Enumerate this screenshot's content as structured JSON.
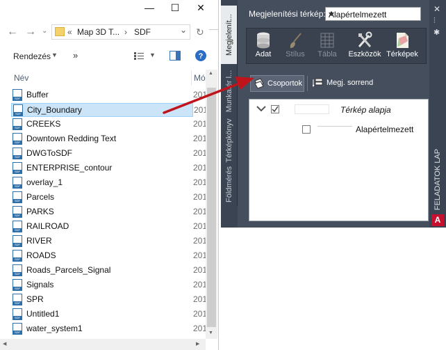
{
  "explorer": {
    "window_controls": {
      "minimize": "—",
      "maximize": "☐",
      "close": "✕"
    },
    "address": {
      "overflow": "«",
      "parent": "Map 3D T...",
      "separator": "›",
      "current": "SDF"
    },
    "toolbar": {
      "organize_label": "Rendezés",
      "more": "»"
    },
    "columns": {
      "name": "Név",
      "modified": "Mó"
    },
    "files": [
      {
        "name": "Buffer",
        "date": "201"
      },
      {
        "name": "City_Boundary",
        "date": "201",
        "selected": true
      },
      {
        "name": "CREEKS",
        "date": "201"
      },
      {
        "name": "Downtown Redding Text",
        "date": "201"
      },
      {
        "name": "DWGToSDF",
        "date": "201"
      },
      {
        "name": "ENTERPRISE_contour",
        "date": "201"
      },
      {
        "name": "overlay_1",
        "date": "201"
      },
      {
        "name": "Parcels",
        "date": "201"
      },
      {
        "name": "PARKS",
        "date": "201"
      },
      {
        "name": "RAILROAD",
        "date": "201"
      },
      {
        "name": "RIVER",
        "date": "201"
      },
      {
        "name": "ROADS",
        "date": "201"
      },
      {
        "name": "Roads_Parcels_Signal",
        "date": "201"
      },
      {
        "name": "Signals",
        "date": "201"
      },
      {
        "name": "SPR",
        "date": "201"
      },
      {
        "name": "Untitled1",
        "date": "201"
      },
      {
        "name": "water_system1",
        "date": "201"
      }
    ]
  },
  "panel": {
    "vertical_tabs": [
      "Megjelenít...",
      "Munkatér l...",
      "Térképkönyv",
      "Földmérés"
    ],
    "map_label": "Megjelenítési térkép:",
    "map_value": "Alapértelmezett",
    "ribbon": [
      {
        "label": "Adat",
        "icon": "database-icon",
        "enabled": true
      },
      {
        "label": "Stílus",
        "icon": "brush-icon",
        "enabled": false
      },
      {
        "label": "Tábla",
        "icon": "table-icon",
        "enabled": false
      },
      {
        "label": "Eszközök",
        "icon": "tools-icon",
        "enabled": true
      },
      {
        "label": "Térképek",
        "icon": "maps-icon",
        "enabled": true
      }
    ],
    "groups_button": "Csoportok",
    "order_button": "Megj. sorrend",
    "tree": {
      "group": "Térkép alapja",
      "layer": "Alapértelmezett"
    },
    "side_title": "FELADATOK LAP",
    "logo": "A"
  },
  "colors": {
    "panel_bg": "#454e5d",
    "selection": "#cce4f7",
    "arrow": "#c0141c",
    "accent_red": "#c8102e"
  }
}
